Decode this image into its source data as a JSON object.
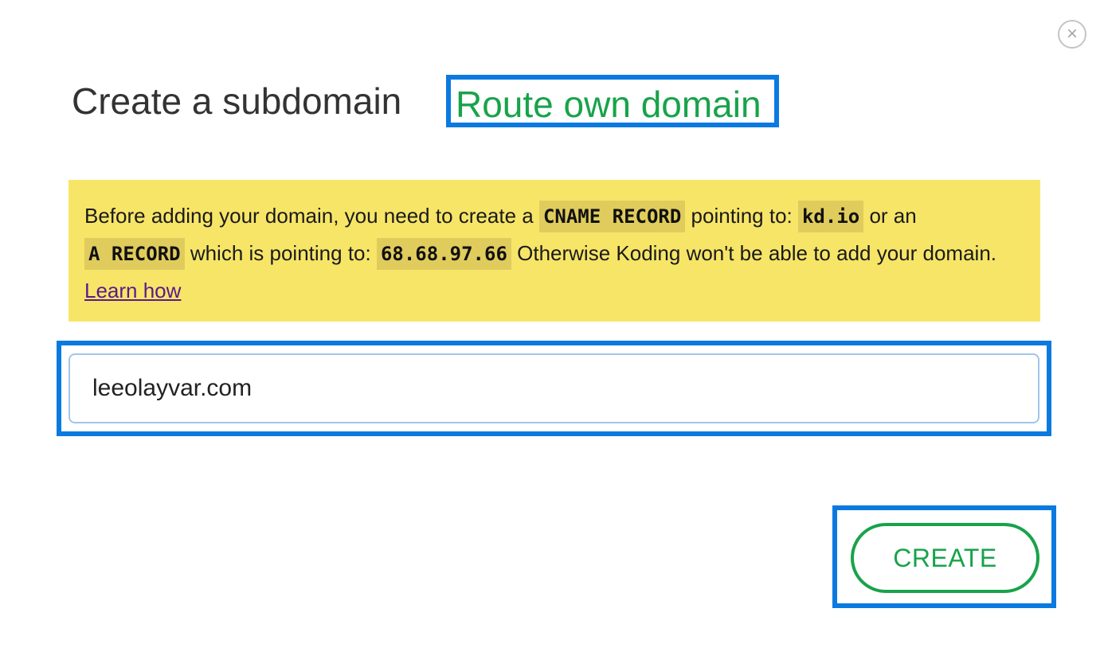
{
  "modal": {
    "close_symbol": "×",
    "close_icon": "close-icon"
  },
  "tabs": {
    "create_subdomain": "Create a subdomain",
    "route_own_domain": "Route own domain"
  },
  "notice": {
    "text1": "Before adding your domain, you need to create a ",
    "cname_record": "CNAME RECORD",
    "text2": " pointing to: ",
    "cname_target": "kd.io",
    "text3": " or an",
    "a_record": "A RECORD",
    "text4": " which is pointing to: ",
    "ip_address": "68.68.97.66",
    "text5": " Otherwise Koding won't be able to add your domain. ",
    "learn_link": "Learn how"
  },
  "domain_input": {
    "value": "leeolayvar.com",
    "placeholder": ""
  },
  "actions": {
    "create_label": "CREATE"
  },
  "colors": {
    "accent_green": "#18a34a",
    "highlight_blue": "#0a7ae0",
    "notice_yellow": "#f7e568"
  }
}
